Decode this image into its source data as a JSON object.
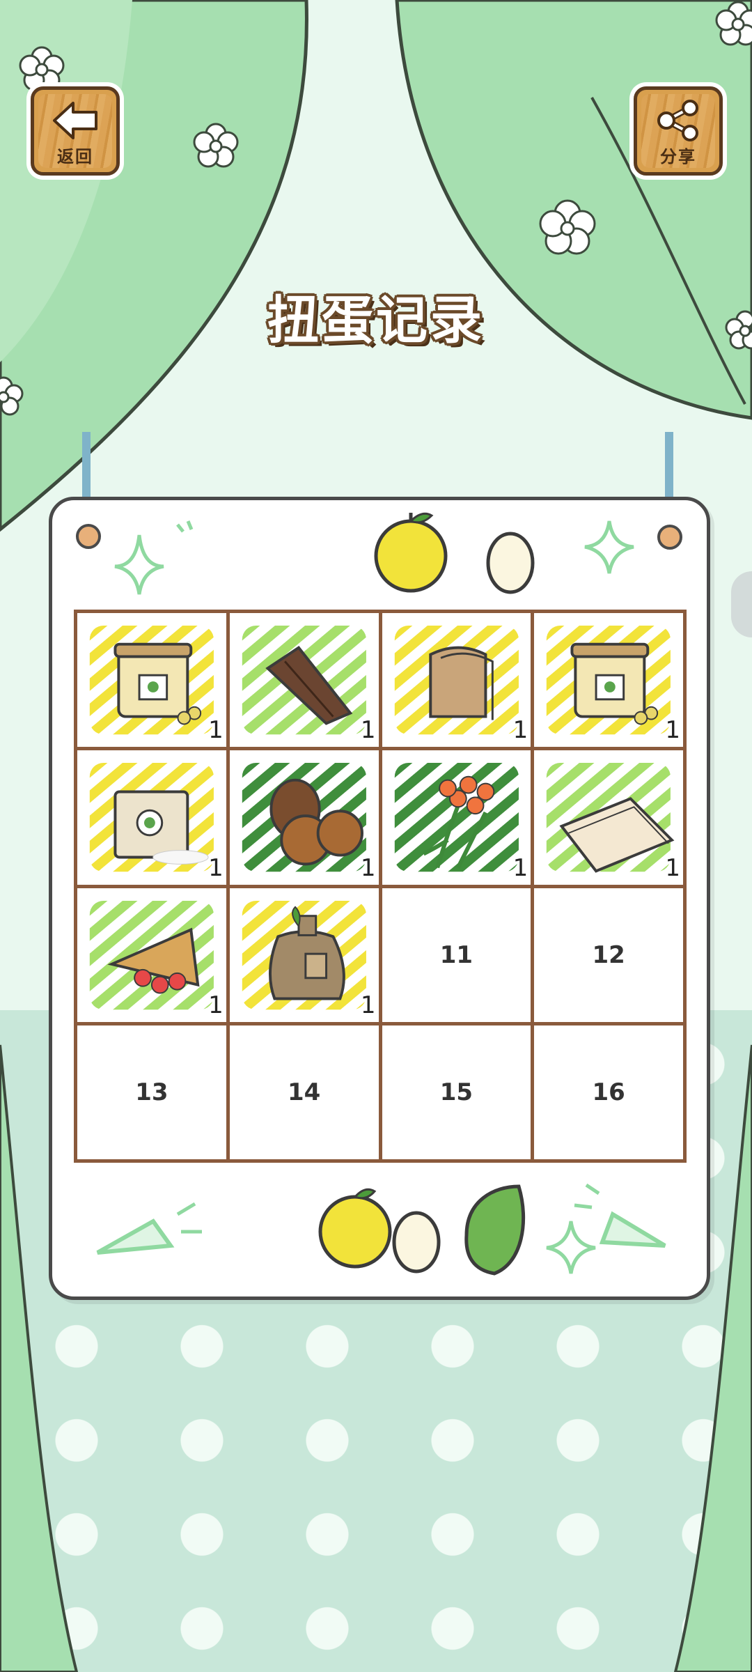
{
  "header": {
    "back_label": "返回",
    "share_label": "分享",
    "title": "扭蛋记录"
  },
  "icons": {
    "back": "arrow-left-icon",
    "share": "share-icon"
  },
  "colors": {
    "curtain": "#a6dfb0",
    "wall": "#e9f8ef",
    "floor": "#c8e7d9",
    "grid_border": "#8a5a3c",
    "yellow": "#f2e33a",
    "light_green": "#a6df6a",
    "dark_green": "#3f8e3c"
  },
  "slots": [
    {
      "item": "nut-jar",
      "bg": "yellow",
      "count": "1"
    },
    {
      "item": "bark-stick",
      "bg": "light_green",
      "count": "1"
    },
    {
      "item": "bread-slices",
      "bg": "yellow",
      "count": "1"
    },
    {
      "item": "nut-jar",
      "bg": "yellow",
      "count": "1"
    },
    {
      "item": "flour-bag",
      "bg": "yellow",
      "count": "1"
    },
    {
      "item": "chestnuts-pinecone",
      "bg": "dark_green",
      "count": "1"
    },
    {
      "item": "orange-flower",
      "bg": "dark_green",
      "count": "1"
    },
    {
      "item": "paper-sheets",
      "bg": "light_green",
      "count": "1"
    },
    {
      "item": "strawberry-cone",
      "bg": "light_green",
      "count": "1"
    },
    {
      "item": "seed-sack",
      "bg": "yellow",
      "count": "1"
    },
    {
      "number": "11"
    },
    {
      "number": "12"
    },
    {
      "number": "13"
    },
    {
      "number": "14"
    },
    {
      "number": "15"
    },
    {
      "number": "16"
    }
  ]
}
